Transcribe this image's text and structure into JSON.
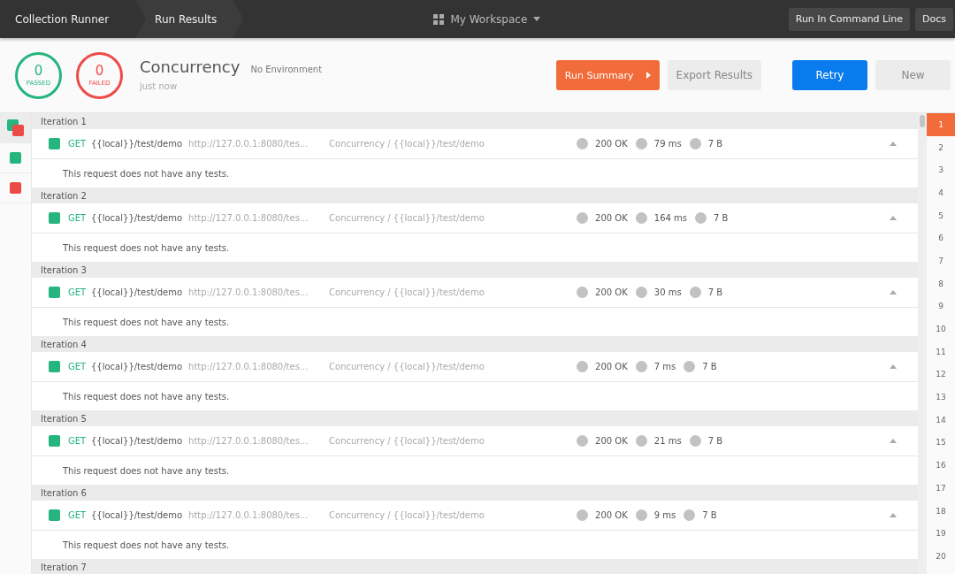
{
  "header": {
    "breadcrumbs": [
      {
        "label": "Collection Runner",
        "selected": false
      },
      {
        "label": "Run Results",
        "selected": true
      }
    ],
    "workspace": "My Workspace",
    "buttons": [
      "Run In Command Line",
      "Docs"
    ]
  },
  "summary": {
    "passed": {
      "count": "0",
      "label": "PASSED"
    },
    "failed": {
      "count": "0",
      "label": "FAILED"
    },
    "collection": "Concurrency",
    "environment": "No Environment",
    "time": "just now",
    "actions": [
      {
        "label": "Run Summary",
        "kind": "summary"
      },
      {
        "label": "Export Results",
        "kind": "secondary"
      },
      {
        "label": "Retry",
        "kind": "primary"
      },
      {
        "label": "New",
        "kind": "secondary"
      }
    ]
  },
  "filters": [
    {
      "kind": "all",
      "selected": true
    },
    {
      "kind": "passed",
      "selected": false
    },
    {
      "kind": "failed",
      "selected": false
    }
  ],
  "iterations": [
    {
      "title": "Iteration 1",
      "request": {
        "color": "#26b47f",
        "method": "GET",
        "name": "{{local}}/test/demo",
        "url": "http://127.0.0.1:8080/tes...",
        "path": "Concurrency / {{local}}/test/demo",
        "status": "200 OK",
        "time": "79 ms",
        "size": "7 B",
        "expanded": true,
        "message": "This request does not have any tests."
      }
    },
    {
      "title": "Iteration 2",
      "request": {
        "color": "#26b47f",
        "method": "GET",
        "name": "{{local}}/test/demo",
        "url": "http://127.0.0.1:8080/tes...",
        "path": "Concurrency / {{local}}/test/demo",
        "status": "200 OK",
        "time": "164 ms",
        "size": "7 B",
        "expanded": true,
        "message": "This request does not have any tests."
      }
    },
    {
      "title": "Iteration 3",
      "request": {
        "color": "#26b47f",
        "method": "GET",
        "name": "{{local}}/test/demo",
        "url": "http://127.0.0.1:8080/tes...",
        "path": "Concurrency / {{local}}/test/demo",
        "status": "200 OK",
        "time": "30 ms",
        "size": "7 B",
        "expanded": true,
        "message": "This request does not have any tests."
      }
    },
    {
      "title": "Iteration 4",
      "request": {
        "color": "#26b47f",
        "method": "GET",
        "name": "{{local}}/test/demo",
        "url": "http://127.0.0.1:8080/tes...",
        "path": "Concurrency / {{local}}/test/demo",
        "status": "200 OK",
        "time": "7 ms",
        "size": "7 B",
        "expanded": true,
        "message": "This request does not have any tests."
      }
    },
    {
      "title": "Iteration 5",
      "request": {
        "color": "#26b47f",
        "method": "GET",
        "name": "{{local}}/test/demo",
        "url": "http://127.0.0.1:8080/tes...",
        "path": "Concurrency / {{local}}/test/demo",
        "status": "200 OK",
        "time": "21 ms",
        "size": "7 B",
        "expanded": true,
        "message": "This request does not have any tests."
      }
    },
    {
      "title": "Iteration 6",
      "request": {
        "color": "#26b47f",
        "method": "GET",
        "name": "{{local}}/test/demo",
        "url": "http://127.0.0.1:8080/tes...",
        "path": "Concurrency / {{local}}/test/demo",
        "status": "200 OK",
        "time": "9 ms",
        "size": "7 B",
        "expanded": true,
        "message": "This request does not have any tests."
      }
    },
    {
      "title": "Iteration 7"
    }
  ],
  "iteration_nav": [
    {
      "label": "1",
      "selected": true
    },
    {
      "label": "2",
      "selected": false
    },
    {
      "label": "3",
      "selected": false
    },
    {
      "label": "4",
      "selected": false
    },
    {
      "label": "5",
      "selected": false
    },
    {
      "label": "6",
      "selected": false
    },
    {
      "label": "7",
      "selected": false
    },
    {
      "label": "8",
      "selected": false
    },
    {
      "label": "9",
      "selected": false
    },
    {
      "label": "10",
      "selected": false
    },
    {
      "label": "11",
      "selected": false
    },
    {
      "label": "12",
      "selected": false
    },
    {
      "label": "13",
      "selected": false
    },
    {
      "label": "14",
      "selected": false
    },
    {
      "label": "15",
      "selected": false
    },
    {
      "label": "16",
      "selected": false
    },
    {
      "label": "17",
      "selected": false
    },
    {
      "label": "18",
      "selected": false
    },
    {
      "label": "19",
      "selected": false
    },
    {
      "label": "20",
      "selected": false
    }
  ]
}
